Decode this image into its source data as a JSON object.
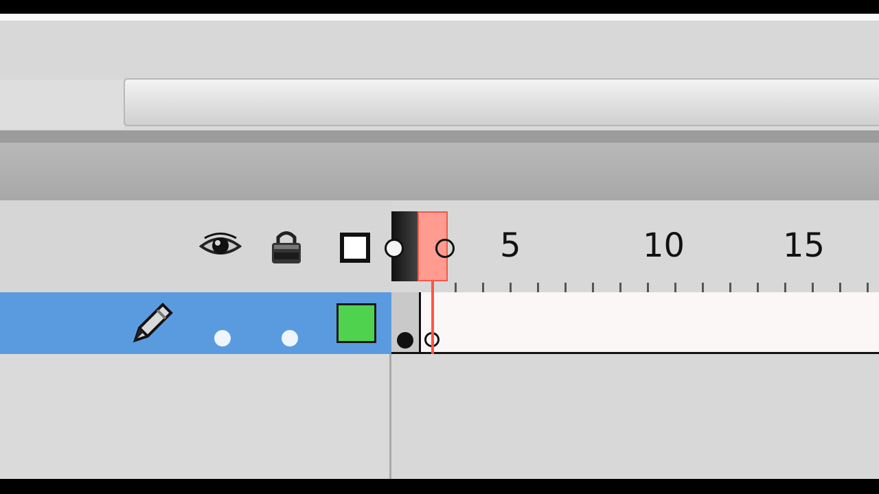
{
  "timeline": {
    "header_icons": [
      "eye-icon",
      "lock-icon",
      "outline-icon"
    ],
    "frame_labels": [
      "5",
      "10",
      "15"
    ],
    "current_frame": 1,
    "layer": {
      "selected": true,
      "icon": "pencil-icon",
      "outline_color": "#4fd34f"
    },
    "colors": {
      "selected_layer": "#5a9be0",
      "playhead": "#ff5545"
    }
  }
}
